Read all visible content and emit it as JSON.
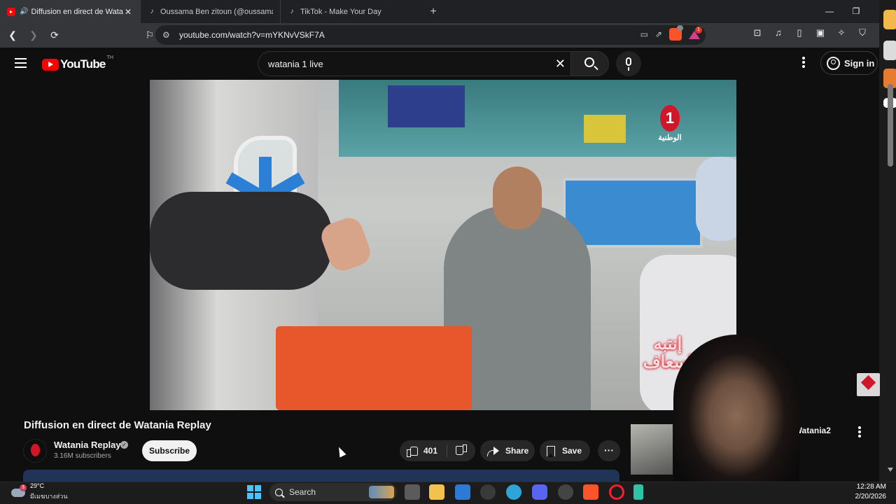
{
  "browser": {
    "tabs": [
      {
        "title": "Diffusion en direct de Watania",
        "active": true
      },
      {
        "title": "Oussama Ben zitoun (@oussama.ben",
        "active": false
      },
      {
        "title": "TikTok - Make Your Day",
        "active": false
      }
    ],
    "url": "youtube.com/watch?v=mYKNvVSkF7A",
    "brave_shield_count": "99+",
    "rewards_badge": "1"
  },
  "youtube": {
    "logo_text": "YouTube",
    "country_code": "TH",
    "search_value": "watania 1 live",
    "signin_label": "Sign in"
  },
  "video": {
    "overlay_logo_number": "1",
    "overlay_logo_text": "الوطنية",
    "overlay_caption": "إنتبه إسعاف",
    "title": "Diffusion en direct de Watania Replay",
    "channel_name": "Watania Replay",
    "subscribers": "3.16M subscribers",
    "subscribe_label": "Subscribe",
    "likes": "401",
    "share_label": "Share",
    "save_label": "Save"
  },
  "recommendation": {
    "title": "t de Watania2"
  },
  "taskbar": {
    "temperature": "29°C",
    "weather_desc": "มีเมฆบางส่วน",
    "weather_badge": "3",
    "search_label": "Search",
    "time": "12:28 AM",
    "date": "2/20/2026"
  },
  "colors": {
    "youtube_red": "#ff0000",
    "watania_red": "#d2162a",
    "background": "#0f0f0f"
  }
}
